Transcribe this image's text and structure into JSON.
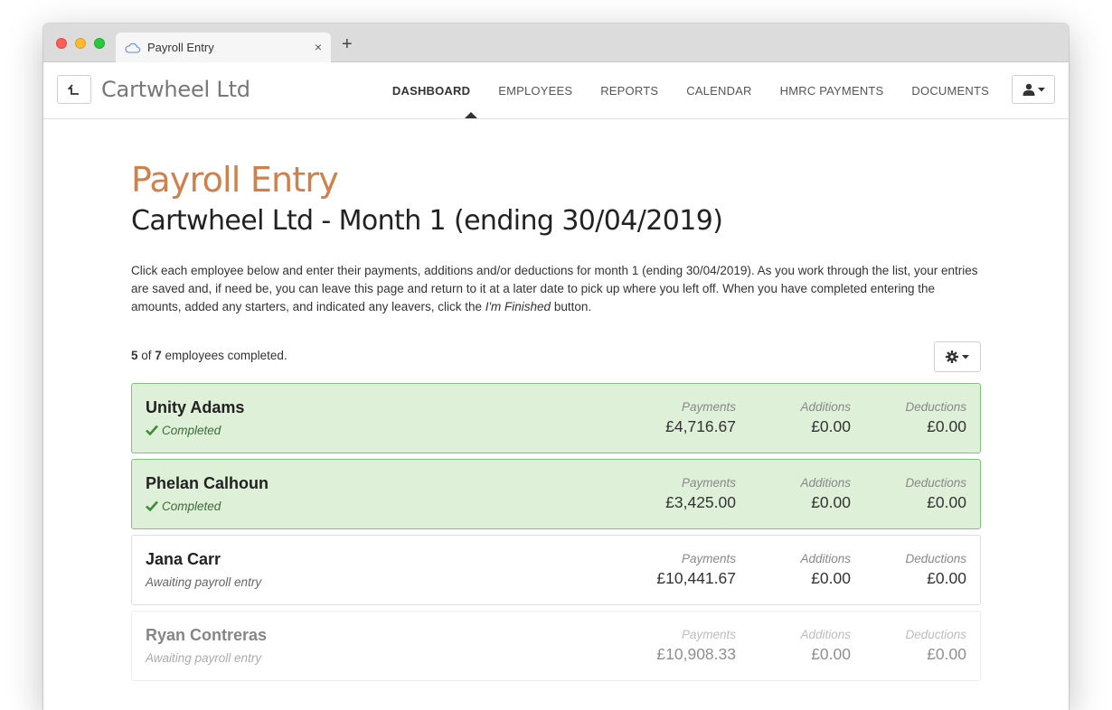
{
  "browser": {
    "tab_title": "Payroll Entry",
    "close_glyph": "×",
    "new_tab_glyph": "+"
  },
  "header": {
    "company_name": "Cartwheel Ltd",
    "nav": [
      {
        "label": "DASHBOARD",
        "active": true
      },
      {
        "label": "EMPLOYEES",
        "active": false
      },
      {
        "label": "REPORTS",
        "active": false
      },
      {
        "label": "CALENDAR",
        "active": false
      },
      {
        "label": "HMRC PAYMENTS",
        "active": false
      },
      {
        "label": "DOCUMENTS",
        "active": false
      }
    ]
  },
  "page": {
    "title": "Payroll Entry",
    "subtitle": "Cartwheel Ltd - Month 1 (ending 30/04/2019)",
    "intro_part1": "Click each employee below and enter their payments, additions and/or deductions for month 1 (ending 30/04/2019). As you work through the list, your entries are saved and, if need be, you can leave this page and return to it at a later date to pick up where you left off. When you have completed entering the amounts, added any starters, and indicated any leavers, click the ",
    "intro_emphasis": "I'm Finished",
    "intro_part2": " button.",
    "completed_count": "5",
    "of_text": " of ",
    "total_count": "7",
    "completed_suffix": " employees completed."
  },
  "column_labels": {
    "payments": "Payments",
    "additions": "Additions",
    "deductions": "Deductions"
  },
  "employees": [
    {
      "name": "Unity Adams",
      "status": "Completed",
      "payments": "£4,716.67",
      "additions": "£0.00",
      "deductions": "£0.00"
    },
    {
      "name": "Phelan Calhoun",
      "status": "Completed",
      "payments": "£3,425.00",
      "additions": "£0.00",
      "deductions": "£0.00"
    },
    {
      "name": "Jana Carr",
      "status": "Awaiting payroll entry",
      "payments": "£10,441.67",
      "additions": "£0.00",
      "deductions": "£0.00"
    },
    {
      "name": "Ryan Contreras",
      "status": "Awaiting payroll entry",
      "payments": "£10,908.33",
      "additions": "£0.00",
      "deductions": "£0.00"
    }
  ],
  "colors": {
    "title_accent": "#d0804a",
    "completed_bg": "#dff0d8",
    "completed_border": "#7cc476",
    "check_green": "#3d8b37"
  },
  "icons": {
    "back": "upload-back-icon",
    "user": "user-icon",
    "settings": "gear-icon",
    "check": "check-icon",
    "cloud": "cloud-icon"
  }
}
